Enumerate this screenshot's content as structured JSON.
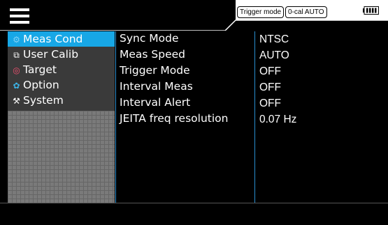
{
  "header": {
    "menu_icon": "hamburger-icon",
    "trigger_badge": "Trigger mode",
    "cal_badge": "0-cal AUTO",
    "battery_icon": "battery-icon"
  },
  "sidebar": {
    "items": [
      {
        "label": "Meas Cond",
        "icon": "gear-icon",
        "glyph": "⚙",
        "active": true
      },
      {
        "label": "User Calib",
        "icon": "calibration-icon",
        "glyph": "⧉",
        "active": false
      },
      {
        "label": "Target",
        "icon": "target-icon",
        "glyph": "◎",
        "active": false
      },
      {
        "label": "Option",
        "icon": "option-gear-icon",
        "glyph": "✿",
        "active": false
      },
      {
        "label": "System",
        "icon": "tools-icon",
        "glyph": "⚒",
        "active": false
      }
    ]
  },
  "settings": {
    "rows": [
      {
        "label": "Sync Mode",
        "value": "NTSC"
      },
      {
        "label": "Meas Speed",
        "value": "AUTO"
      },
      {
        "label": "Trigger Mode",
        "value": "OFF"
      },
      {
        "label": "Interval Meas",
        "value": "OFF"
      },
      {
        "label": "Interval Alert",
        "value": "OFF"
      },
      {
        "label": "JEITA freq resolution",
        "value": "0.07 Hz"
      }
    ]
  },
  "colors": {
    "accent": "#17a7e6",
    "divider": "#2a8fd0",
    "background": "#000000"
  }
}
